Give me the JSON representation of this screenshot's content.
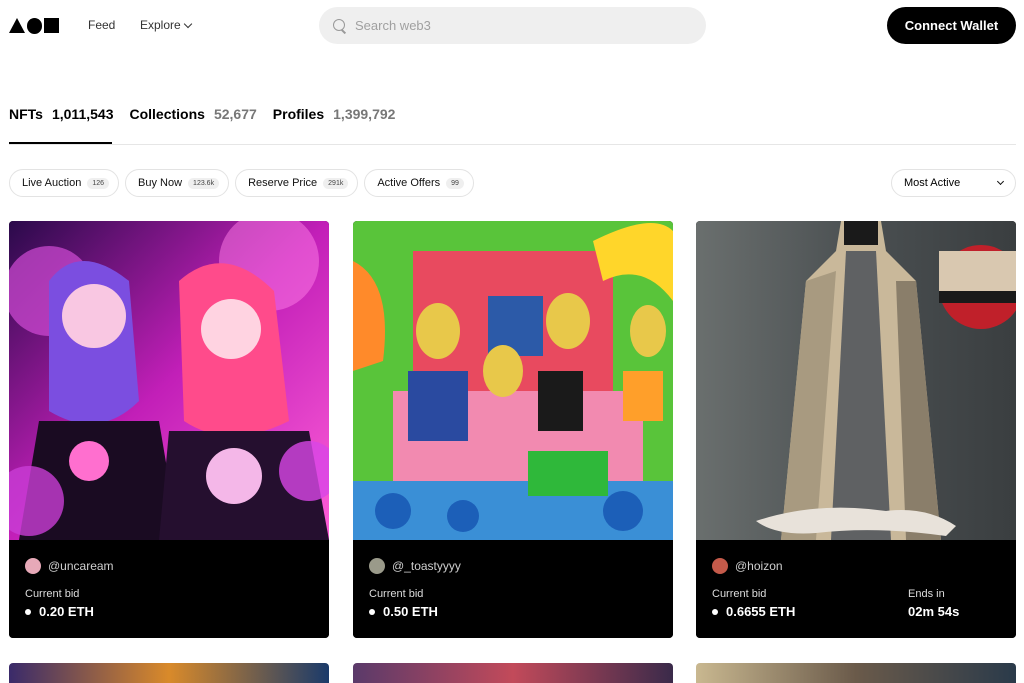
{
  "nav": {
    "feed": "Feed",
    "explore": "Explore",
    "search_placeholder": "Search web3",
    "connect_wallet": "Connect Wallet"
  },
  "stats": [
    {
      "label": "NFTs",
      "count": "1,011,543",
      "active": true
    },
    {
      "label": "Collections",
      "count": "52,677",
      "active": false
    },
    {
      "label": "Profiles",
      "count": "1,399,792",
      "active": false
    }
  ],
  "filters": [
    {
      "label": "Live Auction",
      "badge": "126"
    },
    {
      "label": "Buy Now",
      "badge": "123.6k"
    },
    {
      "label": "Reserve Price",
      "badge": "291k"
    },
    {
      "label": "Active Offers",
      "badge": "99"
    }
  ],
  "sort": {
    "selected": "Most Active"
  },
  "cards": [
    {
      "creator": "@uncaream",
      "bid_label": "Current bid",
      "bid": "0.20 ETH"
    },
    {
      "creator": "@_toastyyyy",
      "bid_label": "Current bid",
      "bid": "0.50 ETH"
    },
    {
      "creator": "@hoizon",
      "bid_label": "Current bid",
      "bid": "0.6655 ETH",
      "ends_label": "Ends in",
      "ends": "02m  54s"
    }
  ],
  "colors": {
    "accent": "#000000",
    "chip_border": "#e3e3e3",
    "search_bg": "#efefef"
  }
}
